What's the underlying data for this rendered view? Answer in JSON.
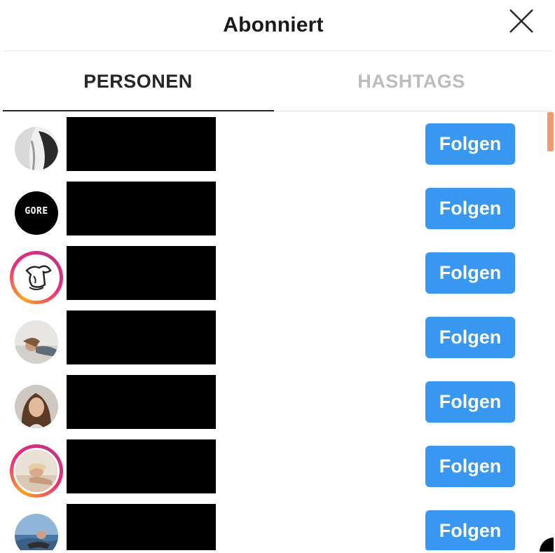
{
  "header": {
    "title": "Abonniert"
  },
  "tabs": [
    {
      "label": "PERSONEN",
      "active": true
    },
    {
      "label": "HASHTAGS",
      "active": false
    }
  ],
  "list": [
    {
      "avatar": "avatar-person-bw",
      "story_ring": false,
      "action": "Folgen"
    },
    {
      "avatar": "avatar-gore-logo",
      "logo_text": "GORE",
      "story_ring": false,
      "action": "Folgen"
    },
    {
      "avatar": "avatar-horse-logo",
      "story_ring": true,
      "action": "Folgen"
    },
    {
      "avatar": "avatar-person-lying",
      "story_ring": false,
      "action": "Folgen"
    },
    {
      "avatar": "avatar-woman-portrait",
      "story_ring": false,
      "action": "Folgen"
    },
    {
      "avatar": "avatar-woman-beach",
      "story_ring": true,
      "action": "Folgen"
    },
    {
      "avatar": "avatar-person-outdoor",
      "story_ring": false,
      "action": "Folgen"
    }
  ],
  "colors": {
    "follow_button": "#3897f0",
    "scroll_thumb": "#f39a6b",
    "inactive_tab": "#bdbdbd",
    "story_ring_start": "#f9a51f",
    "story_ring_end": "#c13584"
  }
}
